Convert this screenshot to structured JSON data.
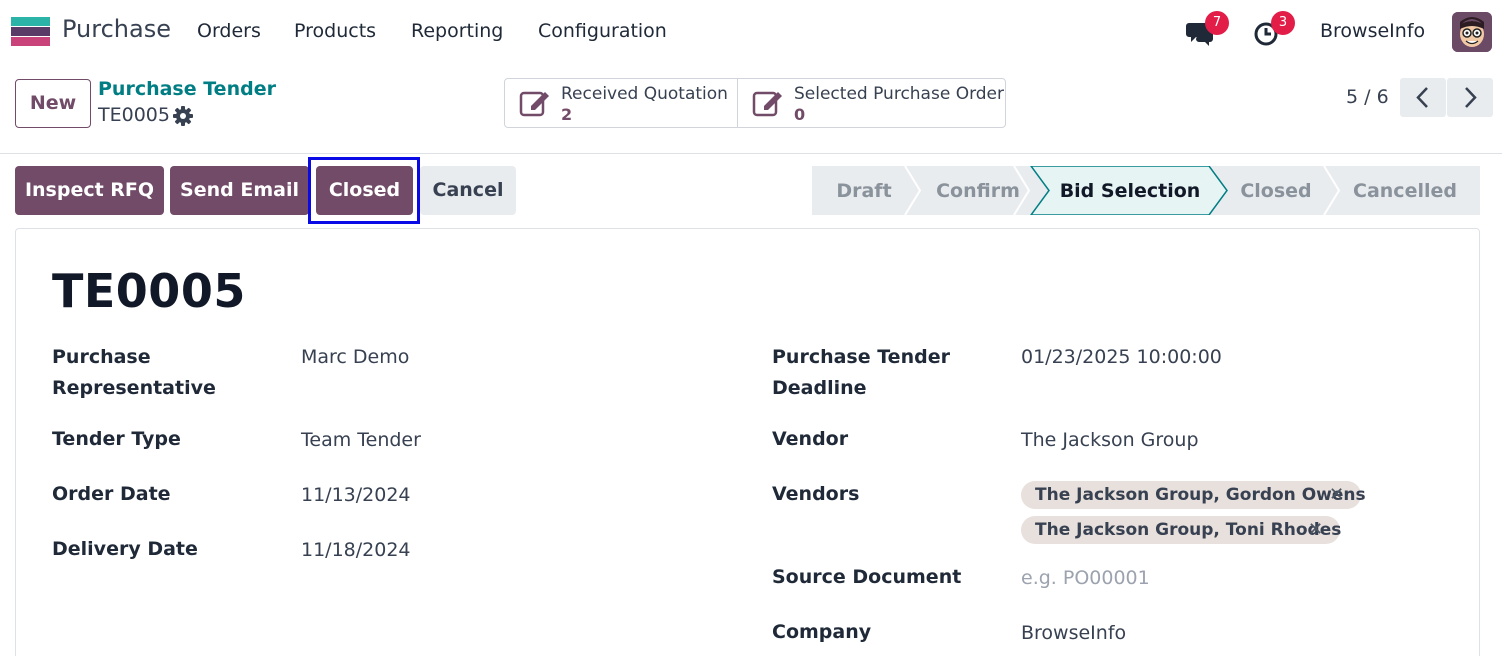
{
  "navbar": {
    "app_name": "Purchase",
    "menu": [
      "Orders",
      "Products",
      "Reporting",
      "Configuration"
    ],
    "messages_count": "7",
    "activities_count": "3",
    "company": "BrowseInfo"
  },
  "control_panel": {
    "new_label": "New",
    "breadcrumb": "Purchase Tender",
    "record_ref": "TE0005",
    "smart_buttons": [
      {
        "label": "Received Quotation",
        "value": "2"
      },
      {
        "label": "Selected Purchase Order",
        "value": "0"
      }
    ],
    "pager": "5 / 6"
  },
  "actions": {
    "inspect_rfq": "Inspect RFQ",
    "send_email": "Send Email",
    "closed": "Closed",
    "cancel": "Cancel"
  },
  "statusbar": {
    "stages": [
      "Draft",
      "Confirm",
      "Bid Selection",
      "Closed",
      "Cancelled"
    ],
    "active": "Bid Selection"
  },
  "form": {
    "title": "TE0005",
    "left": [
      {
        "label": "Purchase Representative",
        "value": "Marc Demo"
      },
      {
        "label": "Tender Type",
        "value": "Team Tender"
      },
      {
        "label": "Order Date",
        "value": "11/13/2024"
      },
      {
        "label": "Delivery Date",
        "value": "11/18/2024"
      }
    ],
    "right": {
      "deadline_label": "Purchase Tender Deadline",
      "deadline_value": "01/23/2025 10:00:00",
      "vendor_label": "Vendor",
      "vendor_value": "The Jackson Group",
      "vendors_label": "Vendors",
      "vendors_tags": [
        "The Jackson Group, Gordon Owens",
        "The Jackson Group, Toni Rhodes"
      ],
      "source_label": "Source Document",
      "source_placeholder": "e.g. PO00001",
      "company_label": "Company",
      "company_value": "BrowseInfo"
    }
  },
  "colors": {
    "primary": "#714b67",
    "link": "#017e84",
    "active_stage": "#e6f4f4",
    "highlight": "#0a0ae6",
    "badge": "#e11d48"
  }
}
